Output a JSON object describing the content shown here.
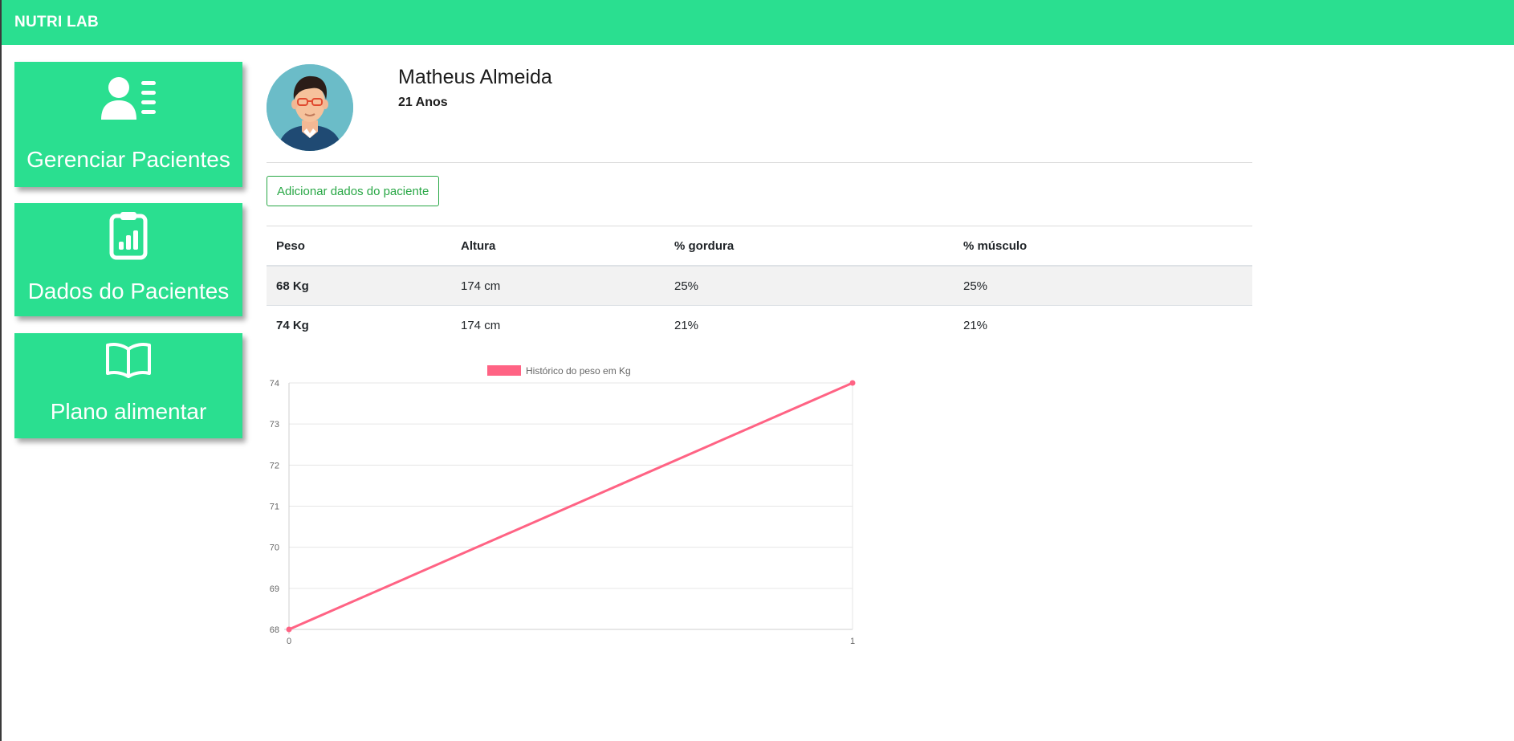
{
  "colors": {
    "brand": "#2adf90",
    "line": "#ff6384",
    "grid": "#e6e6e6"
  },
  "app": {
    "title": "NUTRI LAB"
  },
  "sidebar": {
    "items": [
      {
        "label": "Gerenciar Pacientes",
        "icon": "user-list-icon"
      },
      {
        "label": "Dados do Pacientes",
        "icon": "clipboard-chart-icon"
      },
      {
        "label": "Plano alimentar",
        "icon": "open-book-icon"
      }
    ]
  },
  "patient": {
    "name": "Matheus Almeida",
    "age": "21 Anos"
  },
  "actions": {
    "add_data_label": "Adicionar dados do paciente"
  },
  "table": {
    "headers": [
      "Peso",
      "Altura",
      "% gordura",
      "% músculo"
    ],
    "rows": [
      [
        "68 Kg",
        "174 cm",
        "25%",
        "25%"
      ],
      [
        "74 Kg",
        "174 cm",
        "21%",
        "21%"
      ]
    ]
  },
  "chart_data": {
    "type": "line",
    "x": [
      0,
      1
    ],
    "series": [
      {
        "name": "Histórico do peso em Kg",
        "values": [
          68,
          74
        ]
      }
    ],
    "ylim": [
      68,
      74
    ],
    "yticks": [
      68,
      69,
      70,
      71,
      72,
      73,
      74
    ],
    "xticks": [
      0,
      1
    ],
    "legend": "top",
    "grid": true,
    "title": "",
    "xlabel": "",
    "ylabel": ""
  }
}
